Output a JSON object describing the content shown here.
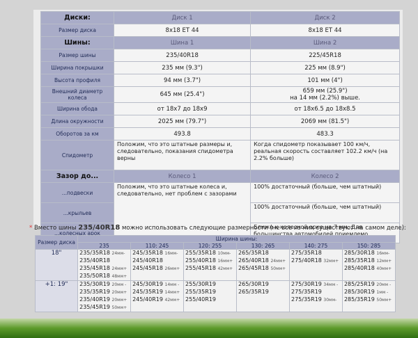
{
  "table1": {
    "rows": [
      {
        "label": "Диски:",
        "c1": "Диск 1",
        "c2": "Диск 2",
        "kind": "head"
      },
      {
        "label": "Размер диска",
        "c1": "8x18 ET 44",
        "c2": "8x18 ET 44"
      },
      {
        "label": "Шины:",
        "c1": "Шина 1",
        "c2": "Шина 2",
        "kind": "head"
      },
      {
        "label": "Размер шины",
        "c1": "235/40R18",
        "c2": "225/45R18"
      },
      {
        "label": "Ширина покрышки",
        "c1": "235 мм (9.3\")",
        "c2": "225 мм (8.9\")"
      },
      {
        "label": "Высота профиля",
        "c1": "94 мм (3.7\")",
        "c2": "101 мм (4\")"
      },
      {
        "label": "Внешний диаметр колеса",
        "c1": "645 мм (25.4\")",
        "c2": "659 мм (25.9\")",
        "c2b": "на 14 мм (2.2%) выше."
      },
      {
        "label": "Ширина обода",
        "c1": "от 18x7 до 18x9",
        "c2": "от 18x6.5 до 18x8.5"
      },
      {
        "label": "Длина окружности",
        "c1": "2025 мм (79.7\")",
        "c2": "2069 мм (81.5\")"
      },
      {
        "label": "Оборотов за км",
        "c1": "493.8",
        "c2": "483.3"
      }
    ],
    "speedometer": {
      "label": "Спидометр",
      "c1": "Положим, что это штатные размеры и, следовательно, показания спидометра верны",
      "c2": "Когда спидометр показывает 100 км/ч, реальная скорость составляет 102.2 км/ч (на 2.2% больше)"
    },
    "clearance": {
      "label": "Зазор до...",
      "h1": "Колесо 1",
      "h2": "Колесо 2",
      "c1": "Положим, что это штатные колеса и, следовательно, нет проблем с зазорами",
      "rows": [
        {
          "label": "...подвески",
          "c2": "100% достаточный (больше, чем штатный)"
        },
        {
          "label": "...крыльев",
          "c2": "100% достаточный (больше, чем штатный)"
        },
        {
          "label": "...колесных арок",
          "c2": "Ближе к колесной арке на 7 мм. Для большинства автомобилей приемлемо."
        }
      ]
    }
  },
  "note": {
    "star": "*",
    "before": "Вместо шины",
    "tire": "235/40R18",
    "after": "можно использовать следующие размерности (не все из них существуют на самом деле):"
  },
  "table2": {
    "diameter_header": "Размер диска",
    "width_header": "Ширина шины:",
    "widths": [
      "235",
      "110: 245",
      "120: 255",
      "130: 265",
      "140: 275",
      "150: 285"
    ],
    "rows": [
      {
        "diameter": "18\"",
        "cells": [
          [
            {
              "t": "235/35R18",
              "s": "24мм-"
            },
            {
              "t": "235/40R18",
              "s": ""
            },
            {
              "t": "235/45R18",
              "s": "24мм+"
            },
            {
              "t": "235/50R18",
              "s": "48мм+"
            }
          ],
          [
            {
              "t": "245/35R18",
              "s": "16мм-"
            },
            {
              "t": "245/40R18",
              "s": ""
            },
            {
              "t": "245/45R18",
              "s": "26мм+"
            }
          ],
          [
            {
              "t": "255/35R18",
              "s": "10мм-"
            },
            {
              "t": "255/40R18",
              "s": "16мм+"
            },
            {
              "t": "255/45R18",
              "s": "42мм+"
            }
          ],
          [
            {
              "t": "265/35R18",
              "s": ""
            },
            {
              "t": "265/40R18",
              "s": "24мм+"
            },
            {
              "t": "265/45R18",
              "s": "50мм+"
            }
          ],
          [
            {
              "t": "275/35R18",
              "s": ""
            },
            {
              "t": "275/40R18",
              "s": "32мм+"
            }
          ],
          [
            {
              "t": "285/30R18",
              "s": "16мм-"
            },
            {
              "t": "285/35R18",
              "s": "12мм+"
            },
            {
              "t": "285/40R18",
              "s": "40мм+"
            }
          ]
        ]
      },
      {
        "diameter": "+1: 19\"",
        "cells": [
          [
            {
              "t": "235/30R19",
              "s": "20мм -"
            },
            {
              "t": "235/35R19",
              "s": "20мм+"
            },
            {
              "t": "235/40R19",
              "s": "20мм+"
            },
            {
              "t": "235/45R19",
              "s": "50мм+"
            }
          ],
          [
            {
              "t": "245/30R19",
              "s": "14мм -"
            },
            {
              "t": "245/35R19",
              "s": "14мм+"
            },
            {
              "t": "245/40R19",
              "s": "42мм+"
            }
          ],
          [
            {
              "t": "255/30R19",
              "s": ""
            },
            {
              "t": "255/35R19",
              "s": ""
            },
            {
              "t": "255/40R19",
              "s": ""
            }
          ],
          [
            {
              "t": "265/30R19",
              "s": ""
            },
            {
              "t": "265/35R19",
              "s": ""
            }
          ],
          [
            {
              "t": "275/30R19",
              "s": "34мм -"
            },
            {
              "t": "275/35R19",
              "s": ""
            },
            {
              "t": "275/35R19",
              "s": "30мм-"
            }
          ],
          [
            {
              "t": "285/25R19",
              "s": "20мм -"
            },
            {
              "t": "285/30R19",
              "s": "1мм -"
            },
            {
              "t": "285/35R19",
              "s": "50мм+"
            }
          ]
        ]
      }
    ]
  },
  "colors": {
    "label_bg": "#a9acc8",
    "cell_bg": "#f4f4f4",
    "page_bg": "#d4d4d4",
    "star": "#dd3333",
    "grass": "#4f8f22"
  }
}
